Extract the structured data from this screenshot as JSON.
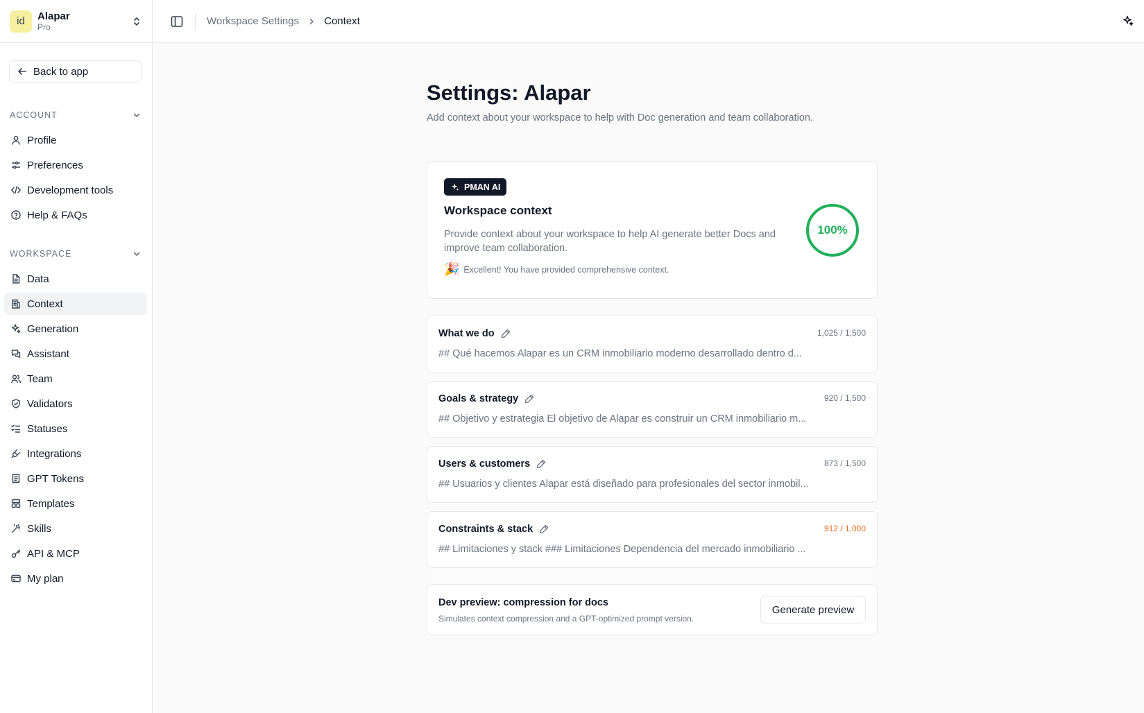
{
  "workspace": {
    "logo_text": "id",
    "name": "Alapar",
    "plan": "Pro"
  },
  "back_label": "Back to app",
  "sections": {
    "account": "ACCOUNT",
    "workspace": "WORKSPACE"
  },
  "account_items": [
    {
      "label": "Profile",
      "icon": "user-icon"
    },
    {
      "label": "Preferences",
      "icon": "sliders-icon"
    },
    {
      "label": "Development tools",
      "icon": "code-icon"
    },
    {
      "label": "Help & FAQs",
      "icon": "help-circle-icon"
    }
  ],
  "workspace_items": [
    {
      "label": "Data",
      "icon": "file-icon"
    },
    {
      "label": "Context",
      "icon": "building-icon"
    },
    {
      "label": "Generation",
      "icon": "sparkles-icon"
    },
    {
      "label": "Assistant",
      "icon": "chat-icon"
    },
    {
      "label": "Team",
      "icon": "users-icon"
    },
    {
      "label": "Validators",
      "icon": "shield-icon"
    },
    {
      "label": "Statuses",
      "icon": "list-checks-icon"
    },
    {
      "label": "Integrations",
      "icon": "plug-icon"
    },
    {
      "label": "GPT Tokens",
      "icon": "receipt-icon"
    },
    {
      "label": "Templates",
      "icon": "layout-icon"
    },
    {
      "label": "Skills",
      "icon": "wand-icon"
    },
    {
      "label": "API & MCP",
      "icon": "key-icon"
    },
    {
      "label": "My plan",
      "icon": "credit-card-icon"
    }
  ],
  "breadcrumb": {
    "parent": "Workspace Settings",
    "current": "Context"
  },
  "page": {
    "title": "Settings: Alapar",
    "subtitle": "Add context about your workspace to help with Doc generation and team collaboration."
  },
  "context_card": {
    "badge": "PMAN AI",
    "title": "Workspace context",
    "description": "Provide context about your workspace to help AI generate better Docs and improve team collaboration.",
    "note_emoji": "🎉",
    "note": "Excellent! You have provided comprehensive context.",
    "completion_label": "100%",
    "completion_fraction": 1.0,
    "ring_color": "#22b05a"
  },
  "context_sections": [
    {
      "title": "What we do",
      "count": "1,025 / 1,500",
      "preview": "## Qué hacemos Alapar es un CRM inmobiliario moderno desarrollado dentro d...",
      "warn": false
    },
    {
      "title": "Goals & strategy",
      "count": "920 / 1,500",
      "preview": "## Objetivo y estrategia El objetivo de Alapar es construir un CRM inmobiliario m...",
      "warn": false
    },
    {
      "title": "Users & customers",
      "count": "873 / 1,500",
      "preview": "## Usuarios y clientes Alapar está diseñado para profesionales del sector inmobil...",
      "warn": false
    },
    {
      "title": "Constraints & stack",
      "count": "912 / 1,000",
      "preview": "## Limitaciones y stack ### Limitaciones Dependencia del mercado inmobiliario ...",
      "warn": true
    }
  ],
  "dev_preview": {
    "title": "Dev preview: compression for docs",
    "description": "Simulates context compression and a GPT-optimized prompt version.",
    "button": "Generate preview"
  }
}
